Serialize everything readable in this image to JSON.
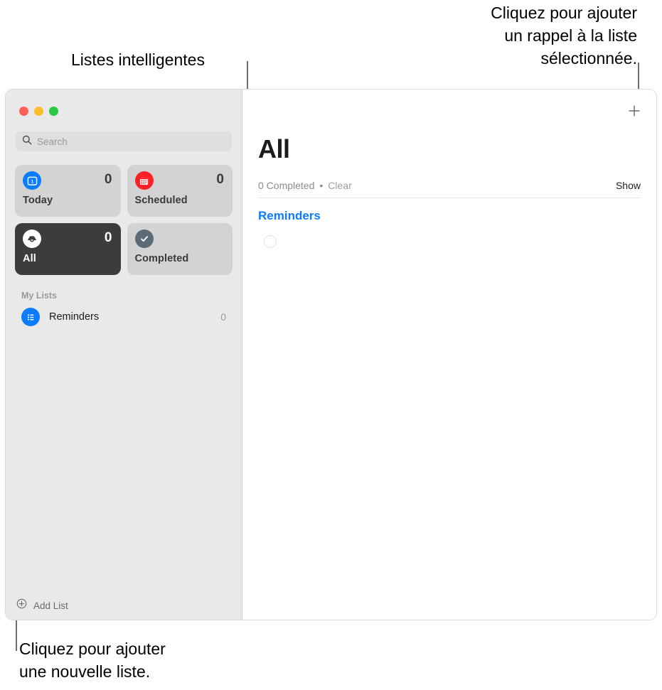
{
  "annotations": {
    "add_reminder": "Cliquez pour ajouter\nun rappel à la liste\nsélectionnée.",
    "smart_lists": "Listes intelligentes",
    "add_list": "Cliquez pour ajouter\nune nouvelle liste."
  },
  "window": {
    "traffic_lights": [
      "close",
      "minimize",
      "maximize"
    ]
  },
  "sidebar": {
    "search": {
      "placeholder": "Search",
      "value": "",
      "icon": "search-icon"
    },
    "smart_lists": [
      {
        "label": "Today",
        "count": "0",
        "icon": "calendar-today-icon",
        "icon_color": "#0a7cff",
        "selected": false
      },
      {
        "label": "Scheduled",
        "count": "0",
        "icon": "calendar-icon",
        "icon_color": "#fc2125",
        "selected": false
      },
      {
        "label": "All",
        "count": "0",
        "icon": "inbox-tray-icon",
        "icon_color": "#ffffff",
        "selected": true
      },
      {
        "label": "Completed",
        "count": "",
        "icon": "checkmark-circle-icon",
        "icon_color": "#5c6b78",
        "selected": false
      }
    ],
    "my_lists_header": "My Lists",
    "lists": [
      {
        "name": "Reminders",
        "count": "0",
        "icon": "bulleted-list-icon",
        "icon_color": "#0a7cff"
      }
    ],
    "add_list": {
      "label": "Add List",
      "icon": "plus-circle-icon"
    }
  },
  "main": {
    "title": "All",
    "add_reminder_icon": "plus-icon",
    "completed_count": "0 Completed",
    "separator_dot": "•",
    "clear_label": "Clear",
    "show_label": "Show",
    "group_title": "Reminders",
    "empty_reminder": "empty-reminder-circle"
  },
  "colors": {
    "accent_blue": "#0a7cff",
    "selected_card": "#3c3c3c",
    "sidebar_bg": "#e9e9e9",
    "card_bg": "#d3d3d3",
    "scheduled_red": "#fc2125",
    "completed_slate": "#5c6b78",
    "annotation_line": "#6e6e6e"
  }
}
